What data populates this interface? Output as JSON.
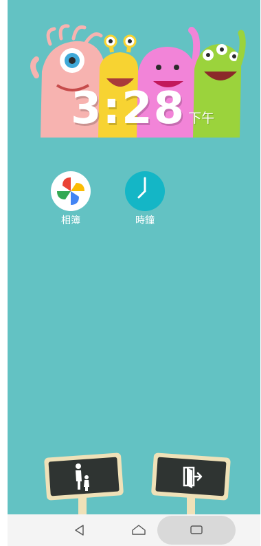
{
  "clock": {
    "time": "3:28",
    "ampm": "下午"
  },
  "apps": [
    {
      "label": "相簿",
      "icon": "photos-pinwheel-icon"
    },
    {
      "label": "時鐘",
      "icon": "clock-icon"
    }
  ],
  "signs": [
    {
      "icon": "parent-child-icon"
    },
    {
      "icon": "exit-door-icon"
    }
  ],
  "navbar": {
    "back_icon": "back-triangle-icon",
    "home_icon": "home-icon",
    "recent_icon": "recent-apps-icon"
  },
  "colors": {
    "wallpaper": "#63c2c3",
    "navbar": "#f4f4f4",
    "clock_icon": "#14b6c6"
  }
}
